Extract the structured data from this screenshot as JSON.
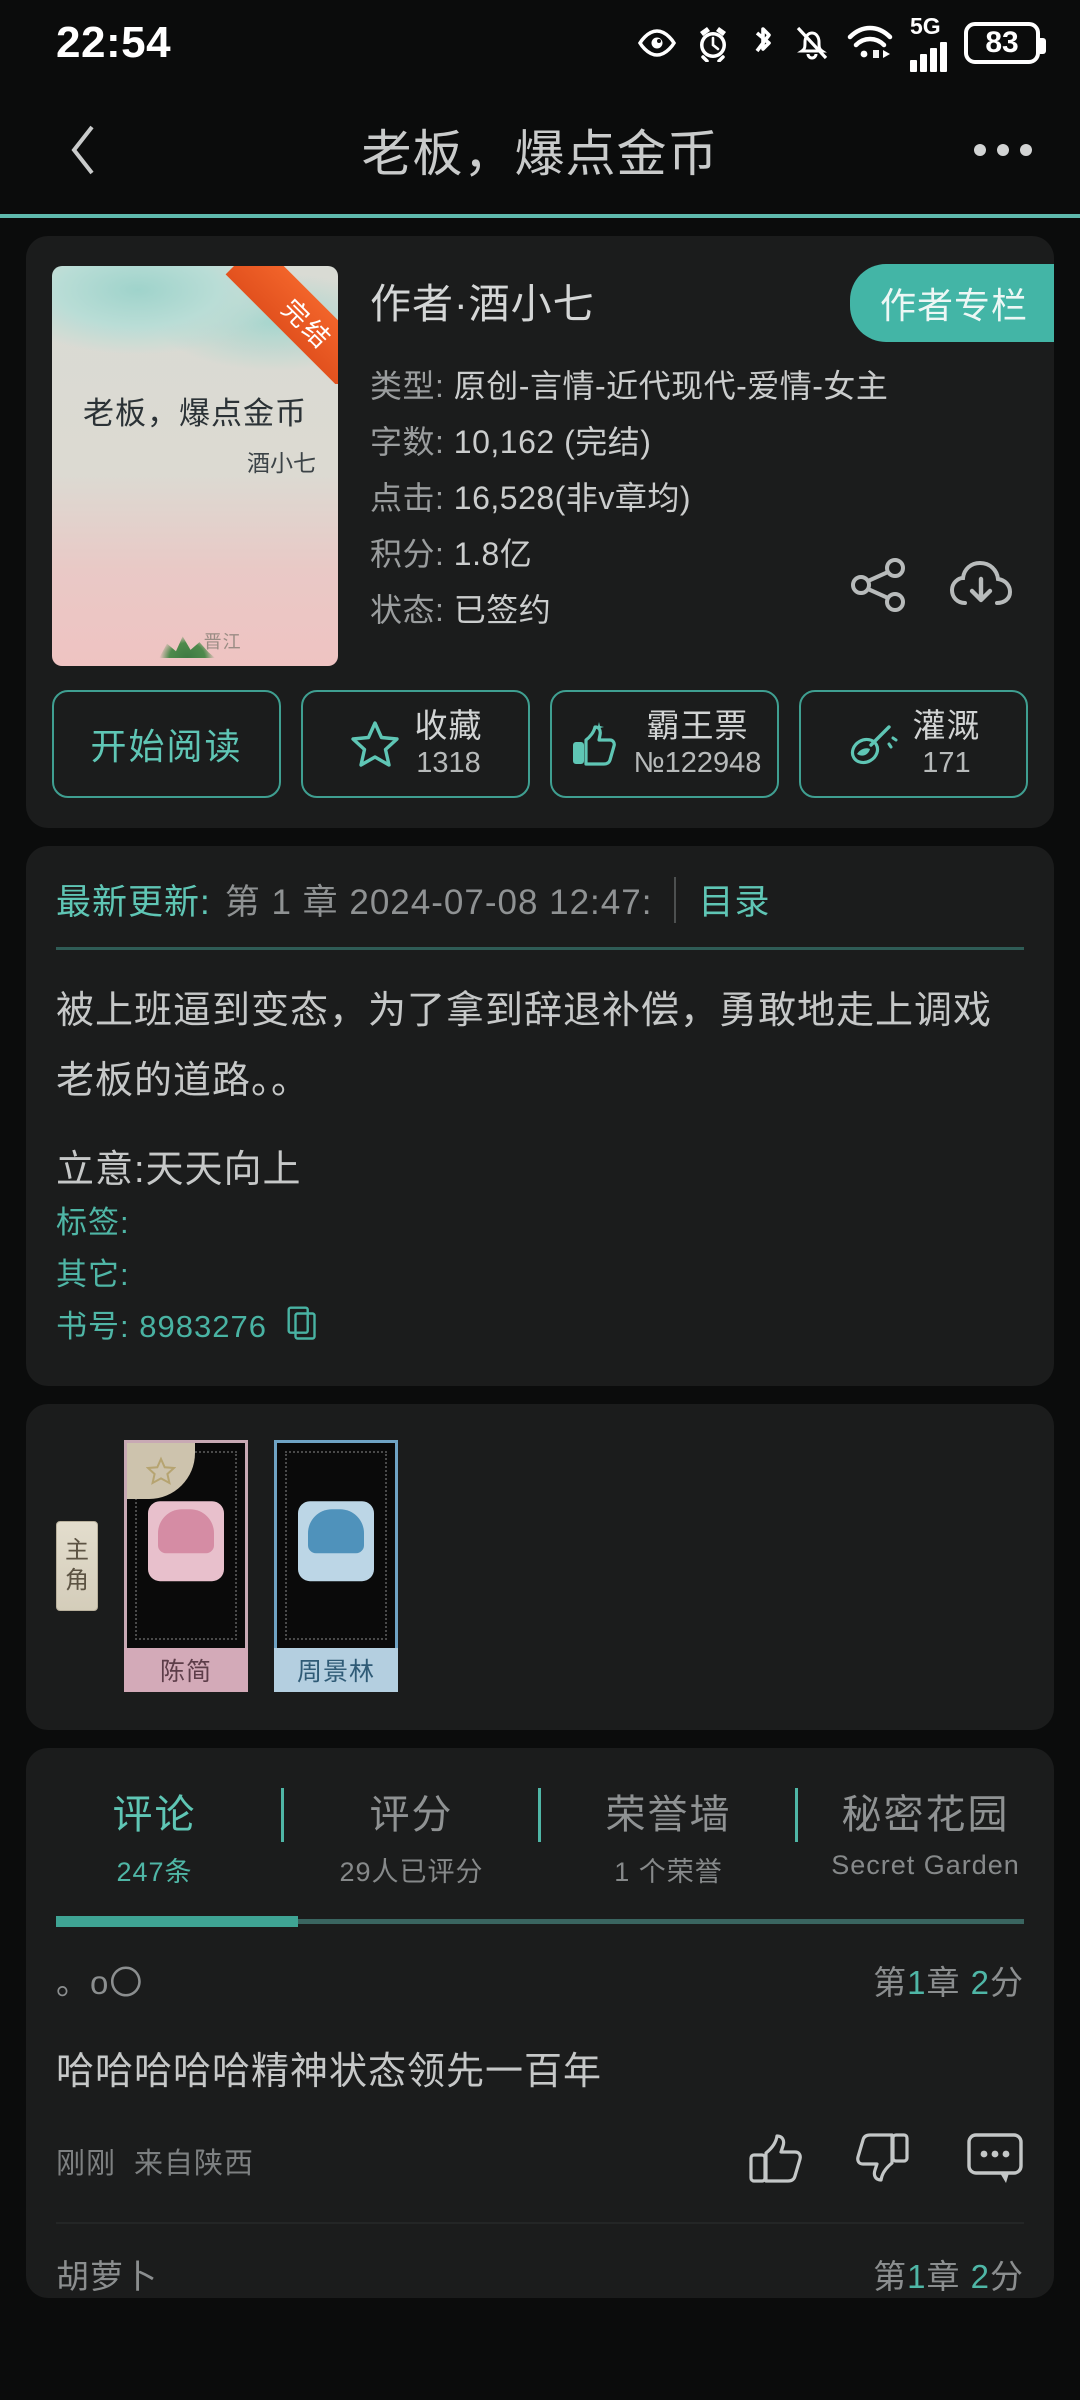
{
  "statusbar": {
    "time": "22:54",
    "battery_percent": "83",
    "network_label": "5G",
    "icons": [
      "eye-icon",
      "alarm-icon",
      "bluetooth-icon",
      "bell-muted-icon",
      "wifi-icon",
      "signal-icon",
      "battery-icon"
    ]
  },
  "nav": {
    "title": "老板，爆点金币",
    "back_icon": "chevron-left-icon",
    "more_icon": "more-horizontal-icon"
  },
  "book": {
    "cover": {
      "title": "老板，爆点金币",
      "author": "酒小七",
      "ribbon": "完结",
      "logo": "晋江"
    },
    "author_line": "作者·酒小七",
    "author_column_btn": "作者专栏",
    "meta": [
      {
        "label": "类型:",
        "value": "原创-言情-近代现代-爱情-女主"
      },
      {
        "label": "字数:",
        "value": "10,162 (完结)"
      },
      {
        "label": "点击:",
        "value": "16,528(非v章均)"
      },
      {
        "label": "积分:",
        "value": "1.8亿"
      },
      {
        "label": "状态:",
        "value": "已签约"
      }
    ],
    "share_icon": "share-icon",
    "download_icon": "cloud-download-icon"
  },
  "actions": [
    {
      "label": "开始阅读",
      "icon": "",
      "count": ""
    },
    {
      "label": "收藏",
      "icon": "star-icon",
      "count": "1318"
    },
    {
      "label": "霸王票",
      "icon": "thumbs-up-icon",
      "count": "№122948"
    },
    {
      "label": "灌溉",
      "icon": "watering-can-icon",
      "count": "171"
    }
  ],
  "update": {
    "label": "最新更新:",
    "chapter": "第 1 章  2024-07-08 12:47:",
    "toc": "目录"
  },
  "description": {
    "text": "被上班逼到变态，为了拿到辞退补偿，勇敢地走上调戏老板的道路。。",
    "intent": "立意:天天向上",
    "tags_label": "标签:",
    "tags_value": "",
    "other_label": "其它:",
    "other_value": "",
    "booknum_label": "书号:",
    "booknum_value": "8983276",
    "copy_icon": "copy-icon"
  },
  "characters": {
    "role_tag": "主角",
    "list": [
      {
        "name": "陈简",
        "gender": "female",
        "star_icon": "star-icon"
      },
      {
        "name": "周景林",
        "gender": "male"
      }
    ]
  },
  "tabs": [
    {
      "label": "评论",
      "sub": "247条",
      "active": true
    },
    {
      "label": "评分",
      "sub": "29人已评分",
      "active": false
    },
    {
      "label": "荣誉墙",
      "sub": "1 个荣誉",
      "active": false
    },
    {
      "label": "秘密花园",
      "sub": "Secret Garden",
      "active": false
    }
  ],
  "comments": [
    {
      "user": "。o〇",
      "chapter": "第",
      "chapter_num": "1",
      "chapter_unit": "章",
      "score": "2",
      "score_unit": "分",
      "body": "哈哈哈哈哈精神状态领先一百年",
      "time": "刚刚",
      "location": "来自陕西",
      "like_icon": "thumbs-up-icon",
      "dislike_icon": "thumbs-down-icon",
      "reply_icon": "comment-icon"
    },
    {
      "user": "胡萝卜",
      "chapter": "第",
      "chapter_num": "1",
      "chapter_unit": "章",
      "score": "2",
      "score_unit": "分"
    }
  ],
  "colors": {
    "accent": "#5fc6b5",
    "accent_dark": "#43b5a6",
    "bg": "#0b0c0c",
    "card": "#1b1c1c",
    "ribbon": "#f2642a"
  }
}
